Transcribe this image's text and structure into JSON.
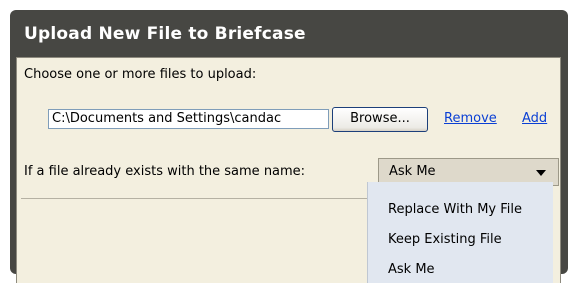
{
  "dialog": {
    "title": "Upload New File to Briefcase",
    "choose_label": "Choose one or more files to upload:",
    "file_path_value": "C:\\Documents and Settings\\candac",
    "browse_label": "Browse...",
    "remove_label": "Remove",
    "add_label": "Add",
    "exists_label": "If a file already exists with the same name:",
    "conflict_select": {
      "selected": "Ask Me",
      "options": [
        "Replace With My File",
        "Keep Existing File",
        "Ask Me"
      ]
    }
  },
  "colors": {
    "frame": "#474743",
    "panel": "#f3efdf",
    "link": "#0a3fd4",
    "dropdown_bg": "#e1e7f0"
  },
  "icons": {
    "select_arrow": "chevron-down-icon"
  }
}
